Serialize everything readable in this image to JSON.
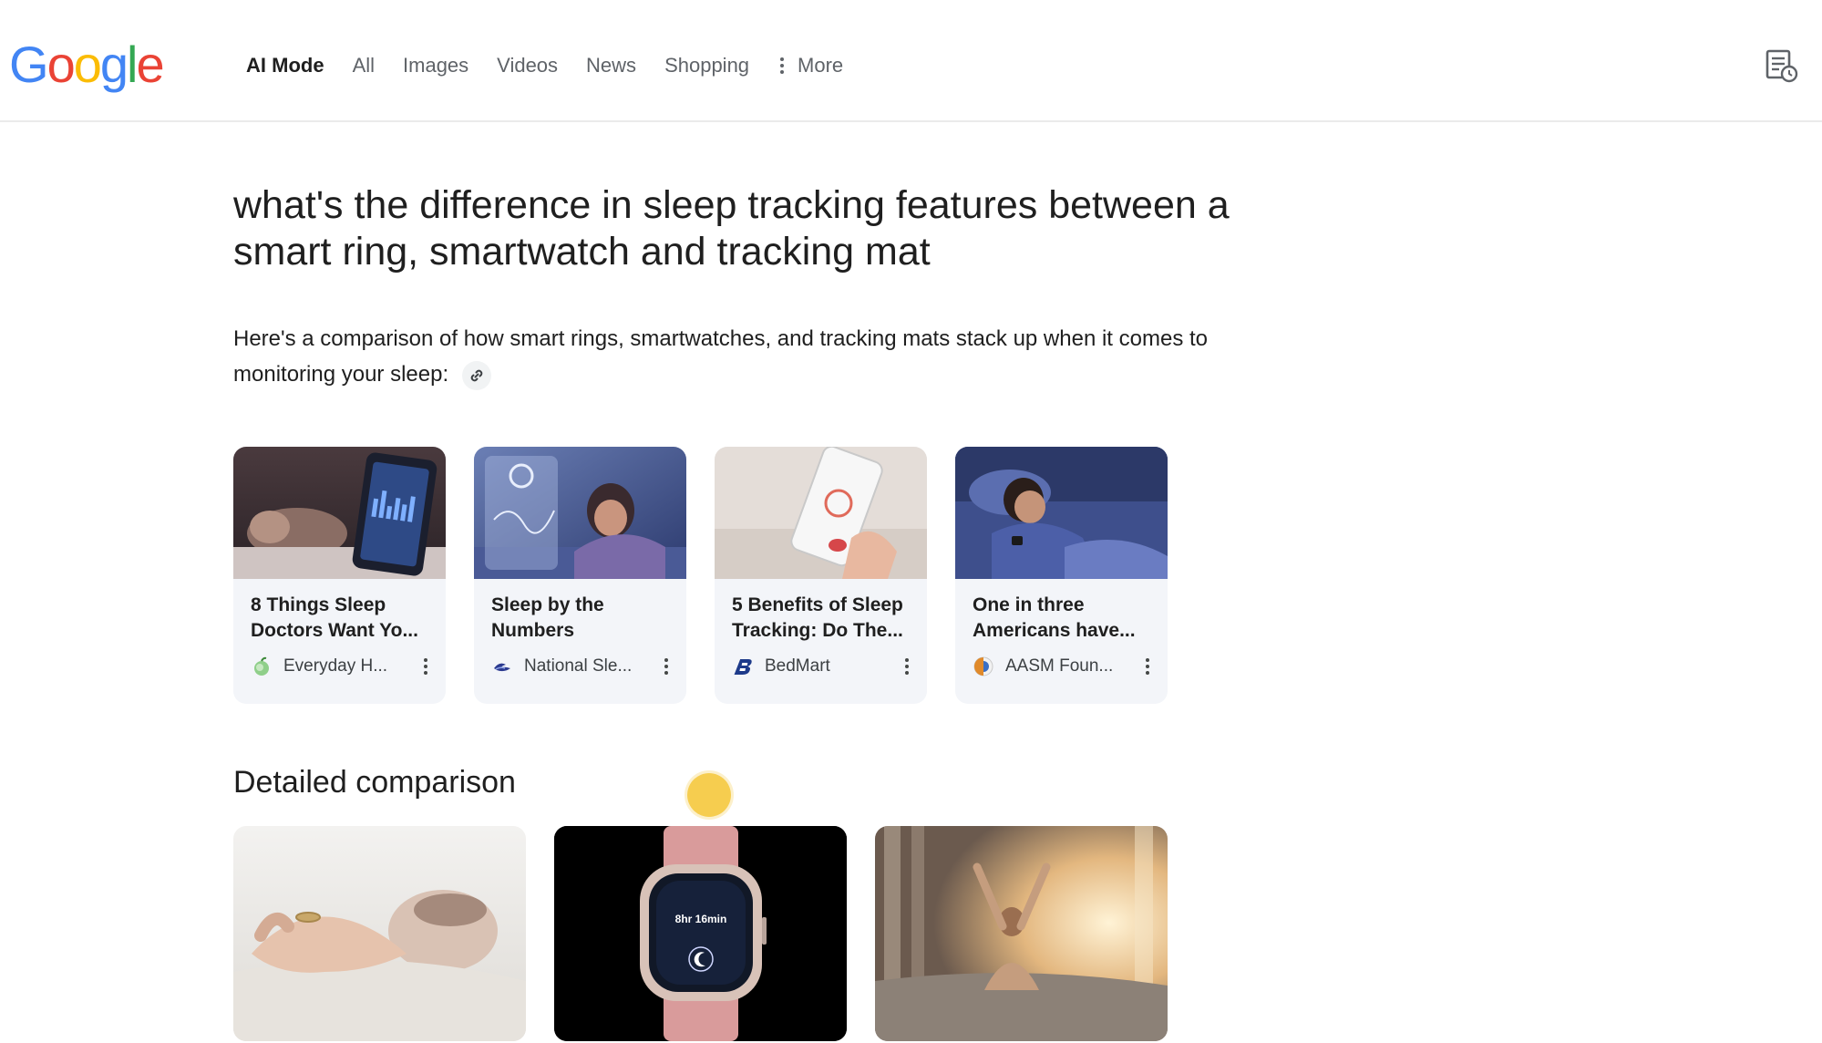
{
  "header": {
    "logo": [
      "G",
      "o",
      "o",
      "g",
      "l",
      "e"
    ],
    "logo_colors": [
      "#4285F4",
      "#EA4335",
      "#FBBC05",
      "#4285F4",
      "#34A853",
      "#EA4335"
    ],
    "nav": [
      {
        "label": "AI Mode",
        "active": true
      },
      {
        "label": "All"
      },
      {
        "label": "Images"
      },
      {
        "label": "Videos"
      },
      {
        "label": "News"
      },
      {
        "label": "Shopping"
      }
    ],
    "more_label": "More",
    "notes_icon": "notes-history-icon"
  },
  "query": {
    "text": "what's the difference in sleep tracking features between a smart ring, smartwatch and tracking mat"
  },
  "answer": {
    "intro": "Here's a comparison of how smart rings, smartwatches, and tracking mats stack up when it comes to monitoring your sleep:",
    "link_icon": "link-icon"
  },
  "sources": [
    {
      "title": "8 Things Sleep Doctors Want Yo...",
      "source": "Everyday H...",
      "icon": "apple-icon",
      "icon_color": "#6fbf73"
    },
    {
      "title": "Sleep by the Numbers",
      "source": "National Sle...",
      "icon": "sleep-foundation-icon",
      "icon_color": "#2b3a8f"
    },
    {
      "title": "5 Benefits of Sleep Tracking: Do The...",
      "source": "BedMart",
      "icon": "bedmart-b-icon",
      "icon_color": "#1d3a8a"
    },
    {
      "title": "One in three Americans have...",
      "source": "AASM Foun...",
      "icon": "aasm-icon",
      "icon_color": "#e08a2b"
    }
  ],
  "detailed": {
    "heading": "Detailed comparison",
    "images": [
      {
        "name": "smart-ring-image"
      },
      {
        "name": "smartwatch-image",
        "watch_time": "8hr 16min"
      },
      {
        "name": "morning-stretch-image"
      }
    ]
  },
  "colors": {
    "text": "#1f1f1f",
    "muted": "#5f6368",
    "card_bg": "#f3f5f9",
    "cursor": "#f4c430"
  }
}
